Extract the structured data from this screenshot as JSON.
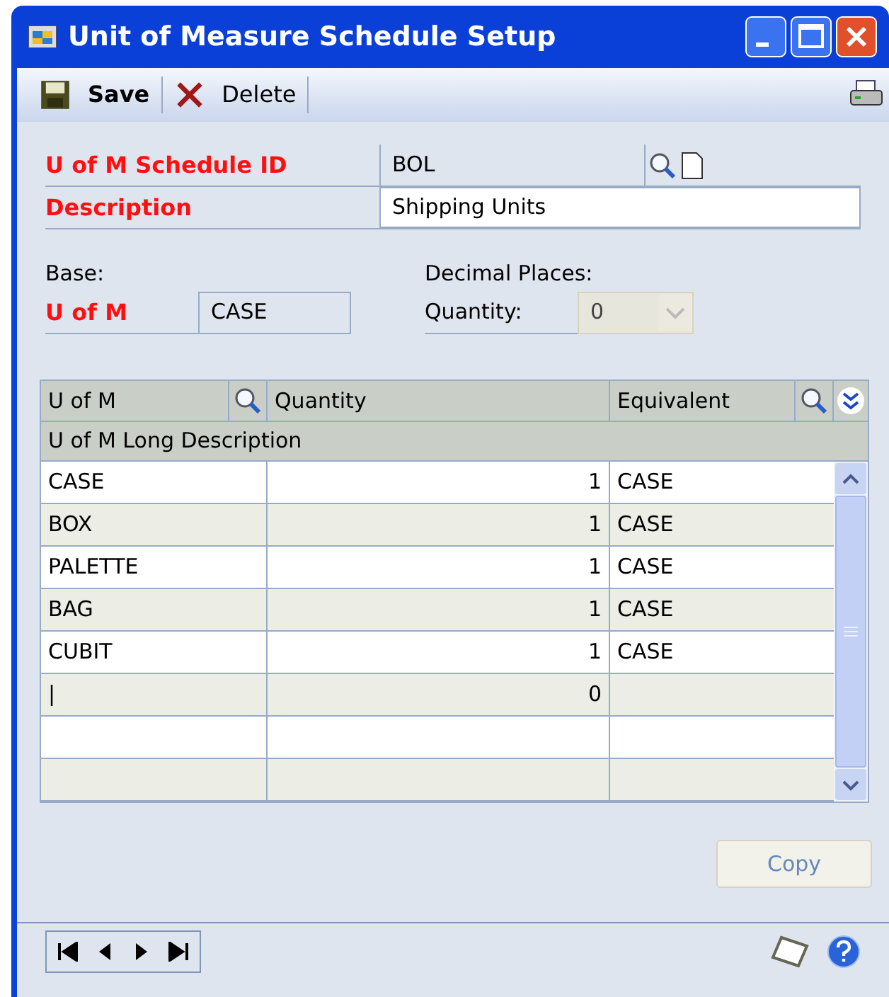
{
  "window": {
    "title": "Unit of Measure Schedule Setup"
  },
  "toolbar": {
    "buttons": [
      {
        "kind": "save",
        "label": "Save"
      },
      {
        "kind": "delete",
        "label": "Delete"
      }
    ]
  },
  "header_fields": [
    {
      "label": "U of M Schedule ID",
      "value": "BOL",
      "kind": "lookup"
    },
    {
      "label": "Description",
      "value": "Shipping Units",
      "kind": "text"
    }
  ],
  "base": {
    "heading": "Base:",
    "label": "U of M",
    "value": "CASE"
  },
  "decimal_places": {
    "heading": "Decimal Places:",
    "label": "Quantity:",
    "value": "0",
    "disabled": true
  },
  "table": {
    "columns": [
      {
        "label": "U of M",
        "lookup": true
      },
      {
        "label": "Quantity",
        "lookup": false
      },
      {
        "label": "Equivalent",
        "lookup": true
      }
    ],
    "second_header": "U of M Long Description",
    "rows": [
      {
        "cells": [
          "CASE",
          "1",
          "CASE"
        ]
      },
      {
        "cells": [
          "BOX",
          "1",
          "CASE"
        ]
      },
      {
        "cells": [
          "PALETTE",
          "1",
          "CASE"
        ]
      },
      {
        "cells": [
          "BAG",
          "1",
          "CASE"
        ]
      },
      {
        "cells": [
          "CUBIT",
          "1",
          "CASE"
        ]
      },
      {
        "cells": [
          "|",
          "0",
          ""
        ]
      },
      {
        "cells": [
          "",
          "",
          ""
        ]
      },
      {
        "cells": [
          "",
          "",
          ""
        ]
      }
    ]
  },
  "copy_button": {
    "label": "Copy",
    "disabled": true
  }
}
